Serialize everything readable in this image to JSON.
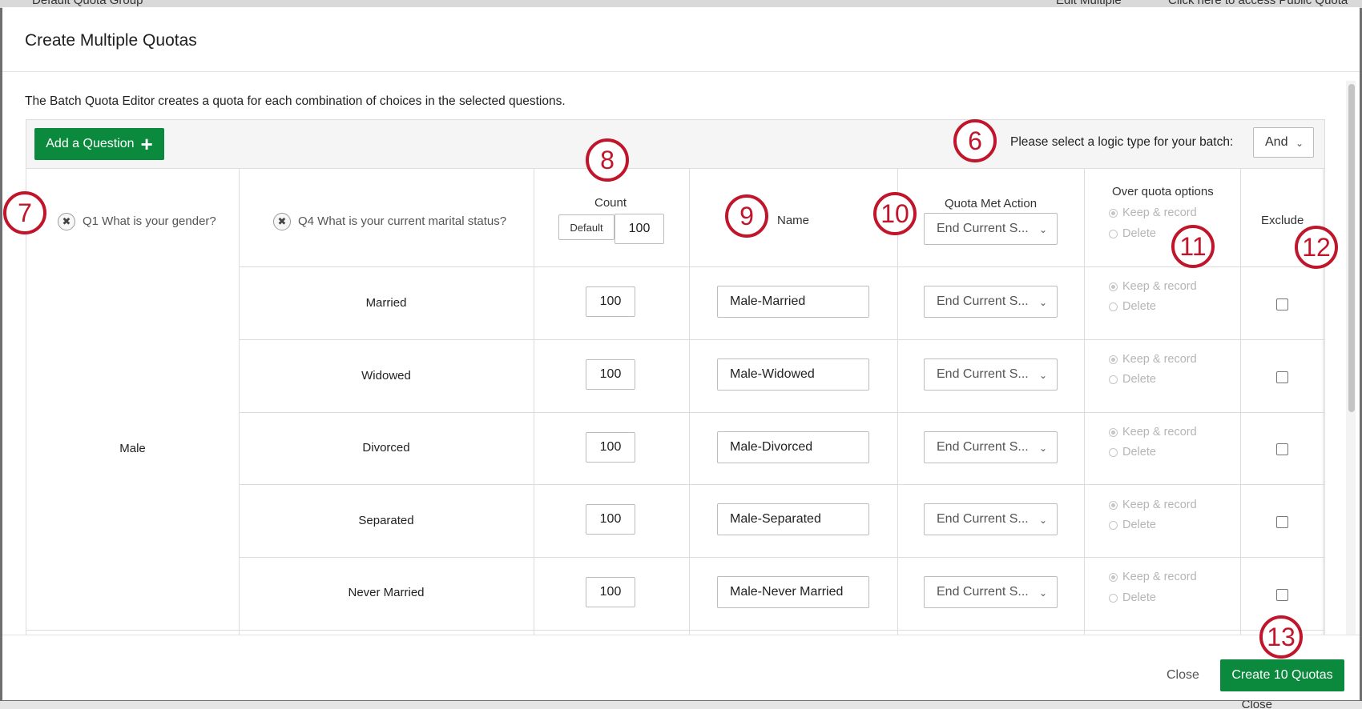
{
  "background": {
    "top_left_text": "Default Quota Group",
    "top_menu": "Edit Multiple",
    "top_right_text": "Click here to access Public Quota",
    "bottom_text": "Close"
  },
  "modal": {
    "title": "Create Multiple Quotas",
    "intro": "The Batch Quota Editor creates a quota for each combination of choices in the selected questions.",
    "toolbar": {
      "add_question_label": "Add a Question",
      "logic_label": "Please select a logic type for your batch:",
      "logic_value": "And"
    },
    "columns": {
      "q1": "Q1 What is your gender?",
      "q4": "Q4 What is your current marital status?",
      "count": "Count",
      "default_label": "Default",
      "default_count": "100",
      "name": "Name",
      "quota_met_action": "Quota Met Action",
      "quota_met_default": "End Current S...",
      "over_quota": "Over quota options",
      "keep_record": "Keep & record",
      "delete": "Delete",
      "exclude": "Exclude"
    },
    "group_label": "Male",
    "rows": [
      {
        "choice": "Married",
        "count": "100",
        "name": "Male-Married",
        "action": "End Current S...",
        "keep": "Keep & record",
        "delete": "Delete"
      },
      {
        "choice": "Widowed",
        "count": "100",
        "name": "Male-Widowed",
        "action": "End Current S...",
        "keep": "Keep & record",
        "delete": "Delete"
      },
      {
        "choice": "Divorced",
        "count": "100",
        "name": "Male-Divorced",
        "action": "End Current S...",
        "keep": "Keep & record",
        "delete": "Delete"
      },
      {
        "choice": "Separated",
        "count": "100",
        "name": "Male-Separated",
        "action": "End Current S...",
        "keep": "Keep & record",
        "delete": "Delete"
      },
      {
        "choice": "Never Married",
        "count": "100",
        "name": "Male-Never Married",
        "action": "End Current S...",
        "keep": "Keep & record",
        "delete": "Delete"
      }
    ],
    "footer": {
      "close_label": "Close",
      "create_label": "Create 10 Quotas"
    }
  },
  "callouts": [
    "6",
    "7",
    "8",
    "9",
    "10",
    "11",
    "12",
    "13"
  ],
  "colors": {
    "accent_green": "#0b8a3e",
    "callout_red": "#c0152b"
  }
}
